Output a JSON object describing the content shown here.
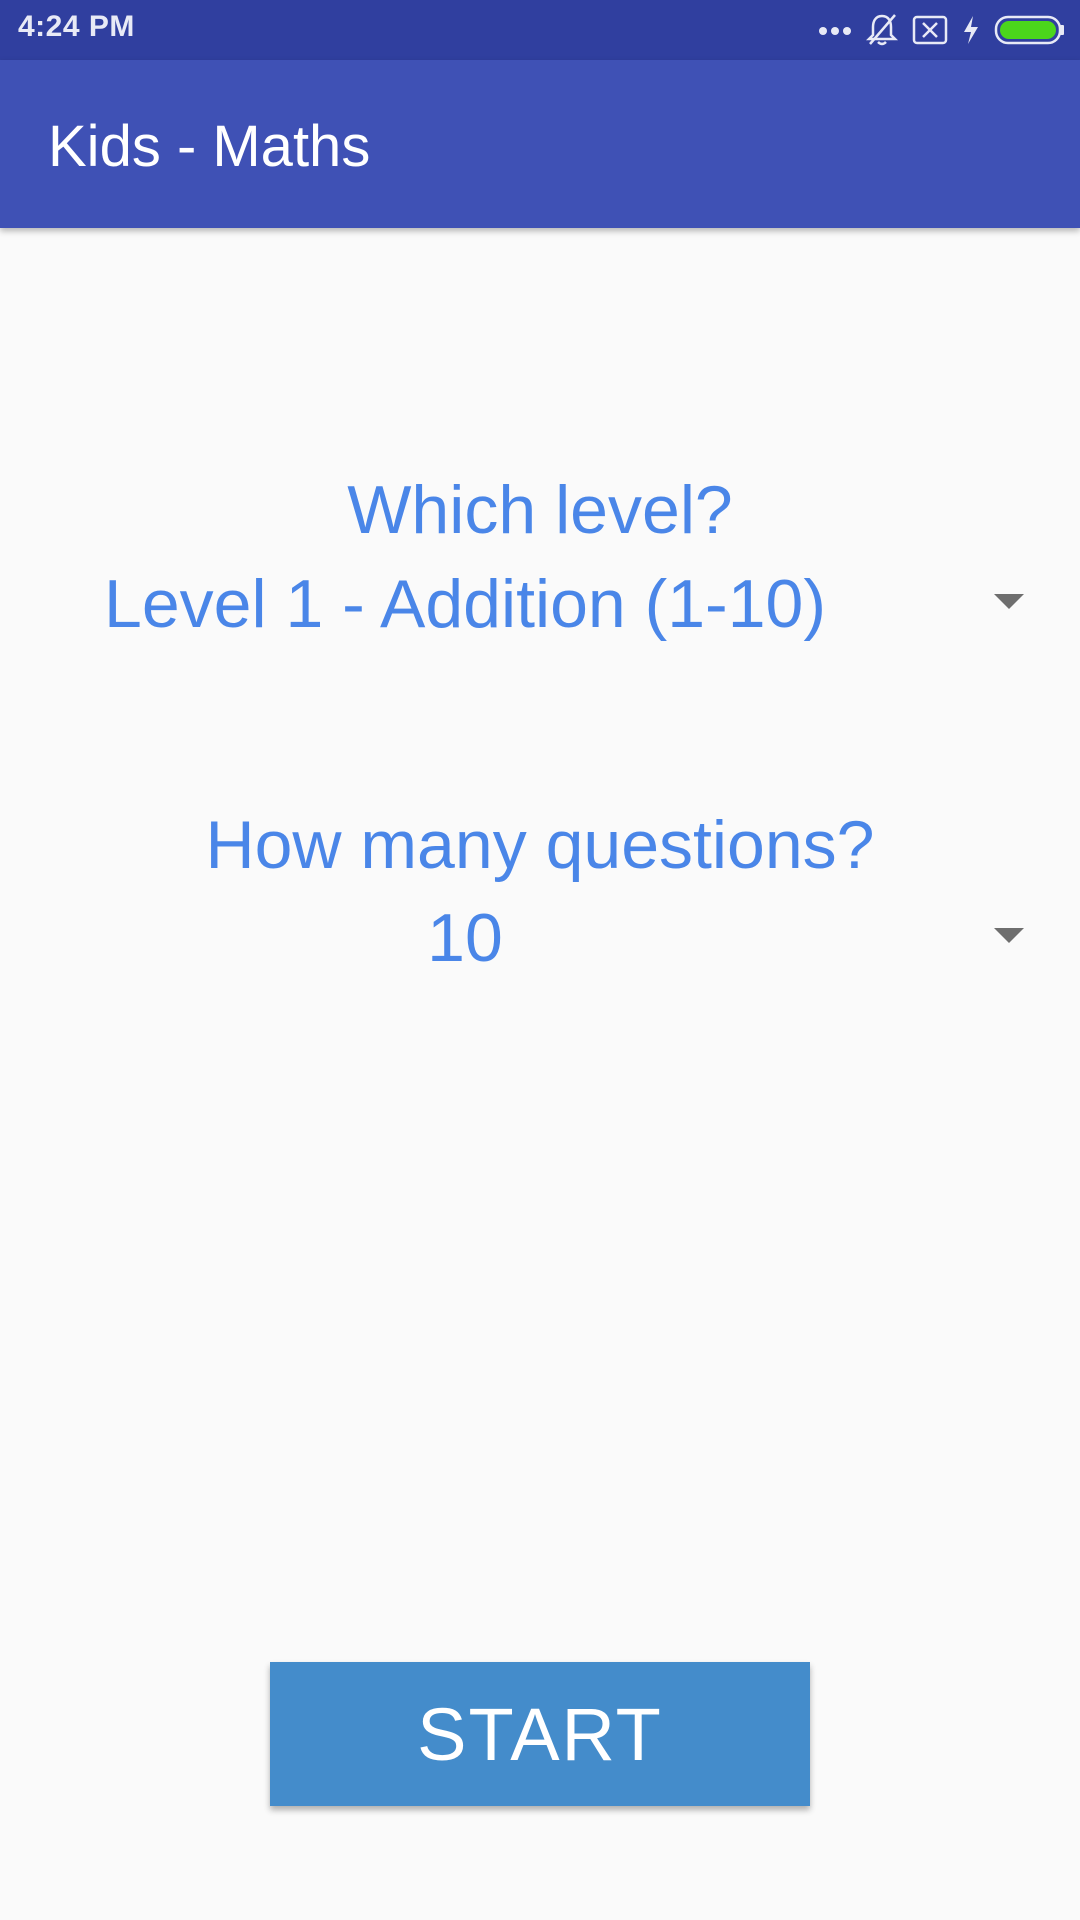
{
  "status_bar": {
    "time": "4:24 PM",
    "icons": [
      "more-icon",
      "bell-off-icon",
      "sim-blocked-icon",
      "charging-icon",
      "battery-icon"
    ],
    "battery_color": "#4bd61c"
  },
  "app_bar": {
    "title": "Kids - Maths",
    "color": "#3f51b5"
  },
  "level": {
    "label": "Which level?",
    "selected": "Level 1 - Addition (1-10)"
  },
  "questions": {
    "label": "How many questions?",
    "selected": "10"
  },
  "start_button": {
    "label": "START",
    "color": "#448ccb"
  },
  "accent_text_color": "#4a86e8"
}
